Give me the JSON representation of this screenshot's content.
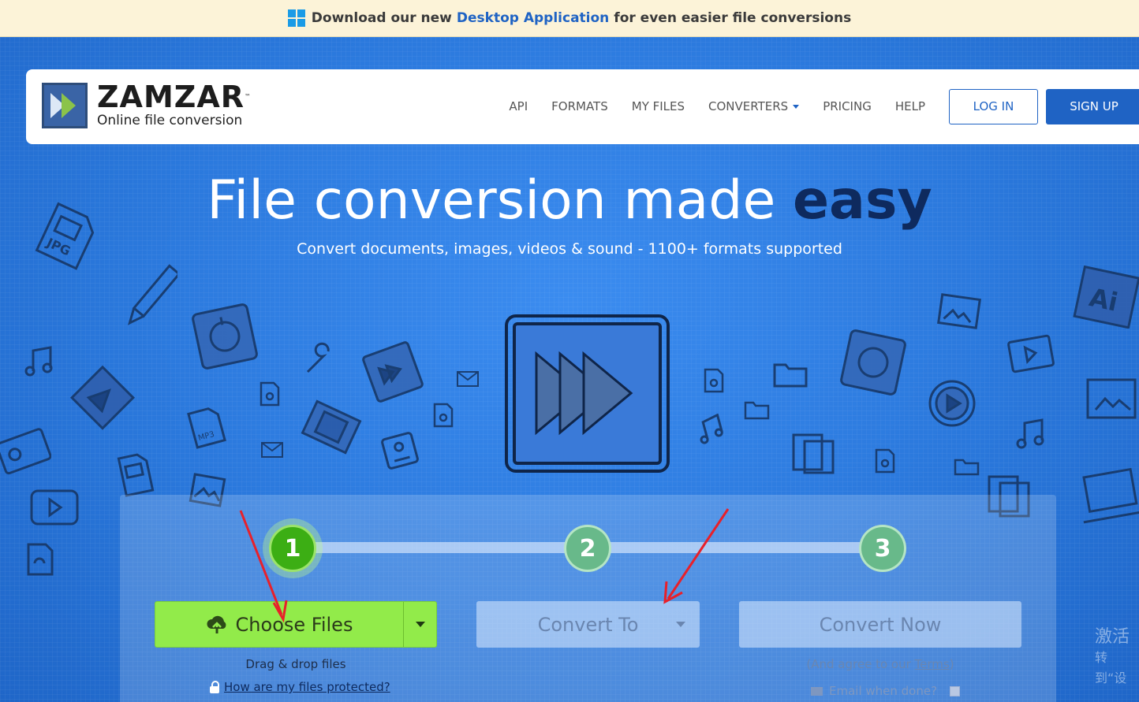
{
  "promo": {
    "prefix": "Download our new",
    "link": "Desktop Application",
    "suffix": "for even easier file conversions"
  },
  "logo": {
    "name": "ZAMZAR",
    "tm": "™",
    "tagline": "Online file conversion"
  },
  "nav": {
    "links": [
      "API",
      "FORMATS",
      "MY FILES",
      "CONVERTERS",
      "PRICING",
      "HELP"
    ],
    "login": "LOG IN",
    "signup": "SIGN UP"
  },
  "hero": {
    "title_regular": "File conversion made",
    "title_bold": "easy",
    "subtitle": "Convert documents, images, videos & sound - 1100+ formats supported"
  },
  "steps": {
    "one": "1",
    "two": "2",
    "three": "3"
  },
  "actions": {
    "choose_files": "Choose Files",
    "drag_drop": "Drag & drop files",
    "protected_link": "How are my files protected?",
    "convert_to": "Convert To",
    "convert_now": "Convert Now",
    "agree_prefix": "(And agree to our",
    "terms_link": "Terms",
    "agree_suffix": ")",
    "email_label": "Email when done?"
  },
  "watermark": {
    "line1": "激活",
    "line2": "转到“设"
  },
  "icons": [
    "windows-icon",
    "zamzar-logo-icon",
    "upload-cloud-icon",
    "chevron-down-icon",
    "lock-icon",
    "envelope-icon"
  ],
  "colors": {
    "brand_blue": "#1f63c4",
    "hero_blue": "#2f7fe0",
    "choose_green": "#92eb4a",
    "step_active": "#3cae14",
    "promo_bg": "#fcf3d8"
  }
}
